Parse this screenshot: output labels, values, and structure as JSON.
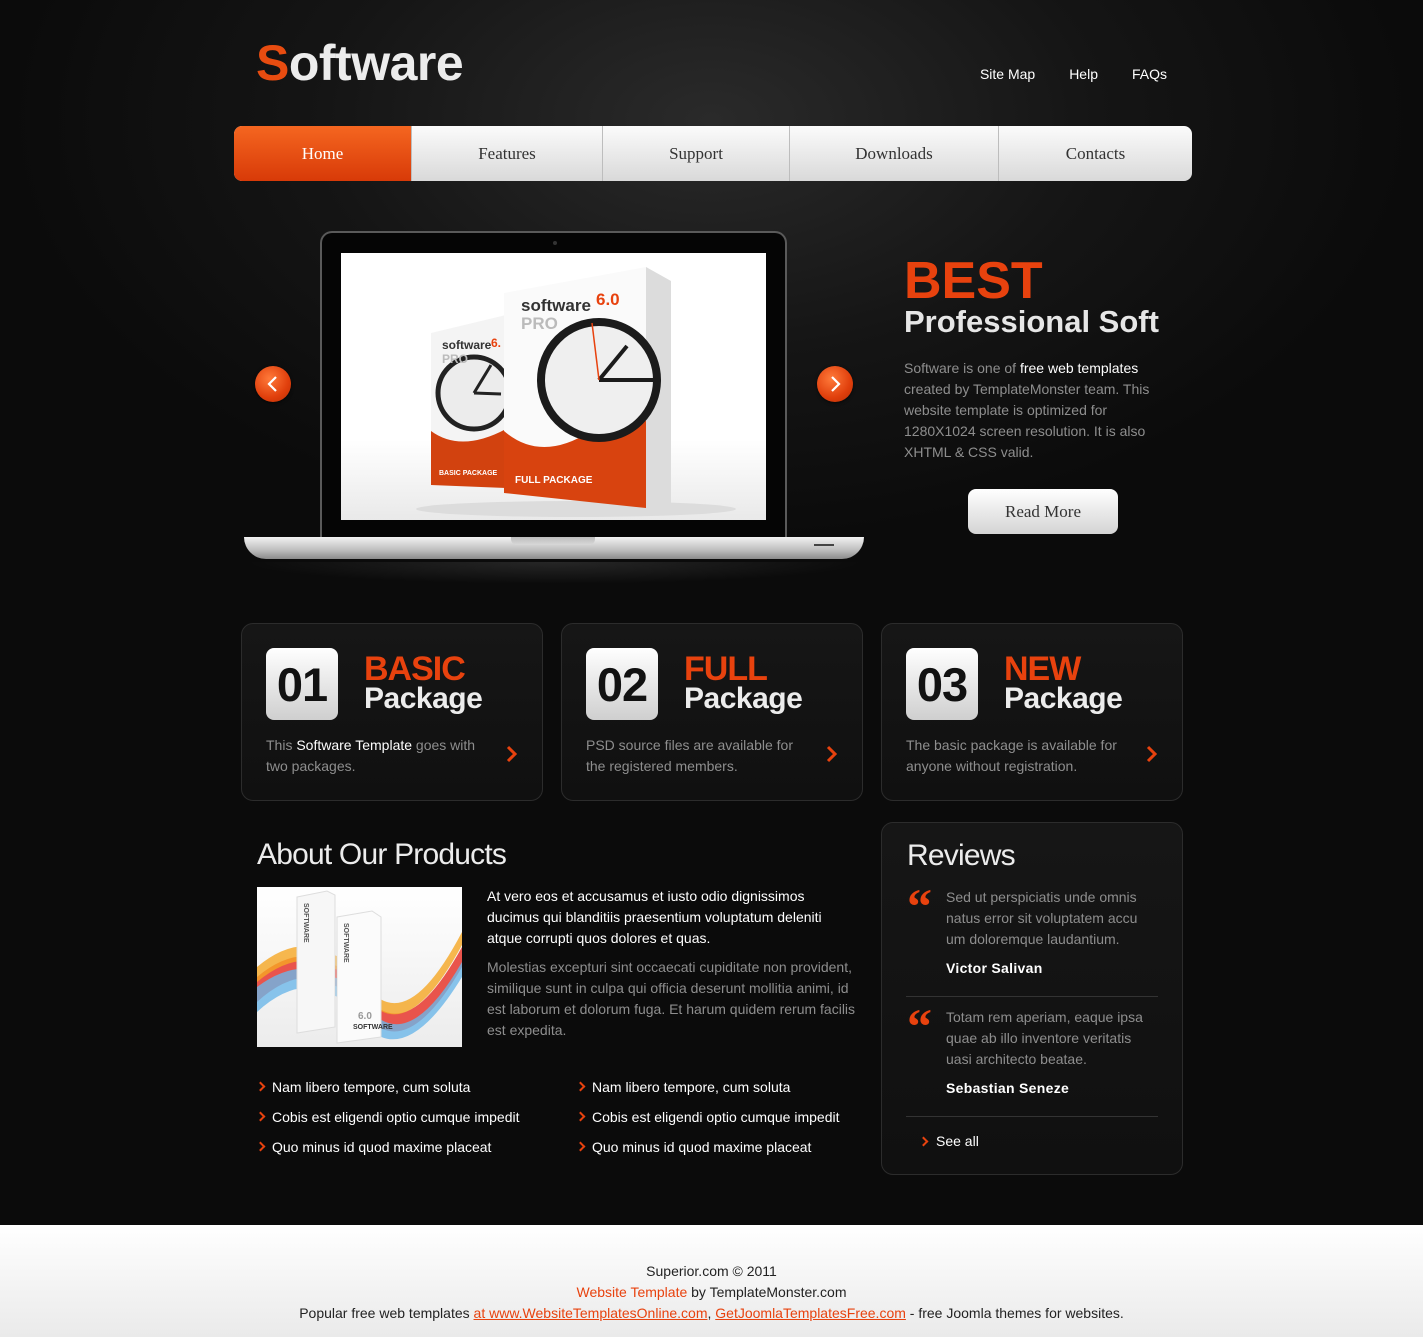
{
  "header": {
    "logo_first": "S",
    "logo_rest": "oftware",
    "links": [
      "Site Map",
      "Help",
      "FAQs"
    ]
  },
  "nav": {
    "items": [
      "Home",
      "Features",
      "Support",
      "Downloads",
      "Contacts"
    ],
    "active": "Home"
  },
  "hero": {
    "title": "BEST",
    "subtitle": "Professional Soft",
    "text_prefix": "Software is one of ",
    "text_link": "free web templates",
    "text_suffix": " created by TemplateMonster team. This website template is optimized for 1280X1024 screen resolution. It is also XHTML & CSS valid.",
    "button": "Read More",
    "product_big_title": "software",
    "product_big_version": "6.0",
    "product_big_edition": "PRO",
    "product_big_label": "FULL PACKAGE",
    "product_small_title": "software",
    "product_small_version": "6.",
    "product_small_edition": "PRO",
    "product_small_label": "BASIC PACKAGE"
  },
  "packages": [
    {
      "num": "01",
      "title": "BASIC",
      "subtitle": "Package",
      "desc_prefix": "This ",
      "desc_link": "Software Template",
      "desc_suffix": " goes with two packages."
    },
    {
      "num": "02",
      "title": "FULL",
      "subtitle": "Package",
      "desc_prefix": "PSD source files are available for the registered members.",
      "desc_link": "",
      "desc_suffix": ""
    },
    {
      "num": "03",
      "title": "NEW",
      "subtitle": "Package",
      "desc_prefix": "The basic package is available for anyone without registration.",
      "desc_link": "",
      "desc_suffix": ""
    }
  ],
  "about": {
    "title": "About Our Products",
    "lead": "At vero eos et accusamus et iusto odio dignissimos ducimus qui blanditiis praesentium voluptatum deleniti atque corrupti quos dolores et quas.",
    "body": "Molestias excepturi sint occaecati cupiditate non provident, similique sunt in culpa qui officia deserunt mollitia animi, id est laborum et dolorum fuga. Et harum quidem rerum facilis est expedita.",
    "box_label": "SOFTWARE",
    "box_version": "6.0",
    "bullets_left": [
      "Nam libero tempore, cum soluta",
      "Cobis est eligendi optio cumque impedit",
      "Quo minus id quod maxime placeat"
    ],
    "bullets_right": [
      "Nam libero tempore, cum soluta",
      "Cobis est eligendi optio cumque impedit",
      "Quo minus id quod maxime placeat"
    ]
  },
  "reviews": {
    "title": "Reviews",
    "items": [
      {
        "text": "Sed ut perspiciatis unde omnis natus error sit voluptatem accu um doloremque laudantium.",
        "author": "Victor Salivan"
      },
      {
        "text": "Totam rem aperiam, eaque ipsa quae ab illo inventore veritatis uasi architecto beatae.",
        "author": "Sebastian Seneze"
      }
    ],
    "see_all": "See all"
  },
  "footer": {
    "copyright": "Superior.com © 2011",
    "line2_link": "Website Template",
    "line2_suffix": " by TemplateMonster.com",
    "line3_prefix": "Popular free web templates ",
    "line3_link1": "at www.WebsiteTemplatesOnline.com",
    "line3_mid": ", ",
    "line3_link2": "GetJoomlaTemplatesFree.com",
    "line3_suffix": " - free Joomla themes for websites."
  },
  "colors": {
    "accent": "#e8420e",
    "background": "#0b0b0b",
    "muted_text": "#8e8e8e"
  }
}
